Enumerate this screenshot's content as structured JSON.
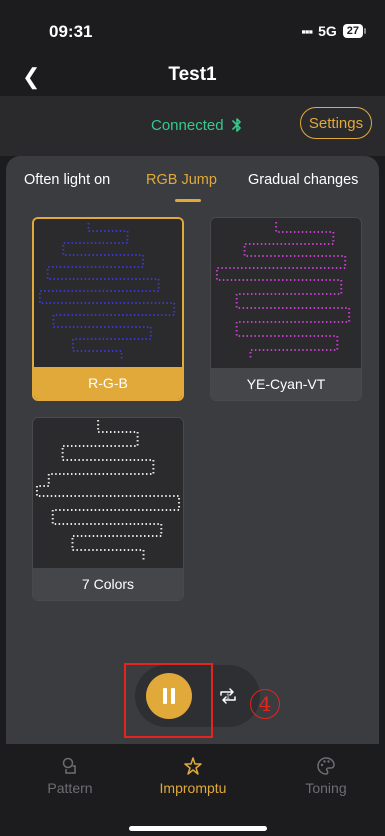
{
  "status_bar": {
    "time": "09:31",
    "network": "5G",
    "battery": "27"
  },
  "header": {
    "title": "Test1"
  },
  "connection": {
    "status": "Connected",
    "settings_label": "Settings"
  },
  "tabs": [
    {
      "label": "Often light on",
      "active": false
    },
    {
      "label": "RGB Jump",
      "active": true
    },
    {
      "label": "Gradual changes",
      "active": false
    }
  ],
  "patterns": [
    {
      "label": "R-G-B",
      "selected": true,
      "dot_color": "#3a3ac8"
    },
    {
      "label": "YE-Cyan-VT",
      "selected": false,
      "dot_color": "#c040c8"
    },
    {
      "label": "7 Colors",
      "selected": false,
      "dot_color": "#e6e6e6"
    }
  ],
  "annotation": {
    "number": "4"
  },
  "bottom_nav": [
    {
      "label": "Pattern",
      "icon": "pattern-icon",
      "active": false
    },
    {
      "label": "Impromptu",
      "icon": "impromptu-icon",
      "active": true
    },
    {
      "label": "Toning",
      "icon": "palette-icon",
      "active": false
    }
  ],
  "colors": {
    "accent": "#e0a93a",
    "connected": "#36c98a",
    "annotation": "#e52420"
  }
}
